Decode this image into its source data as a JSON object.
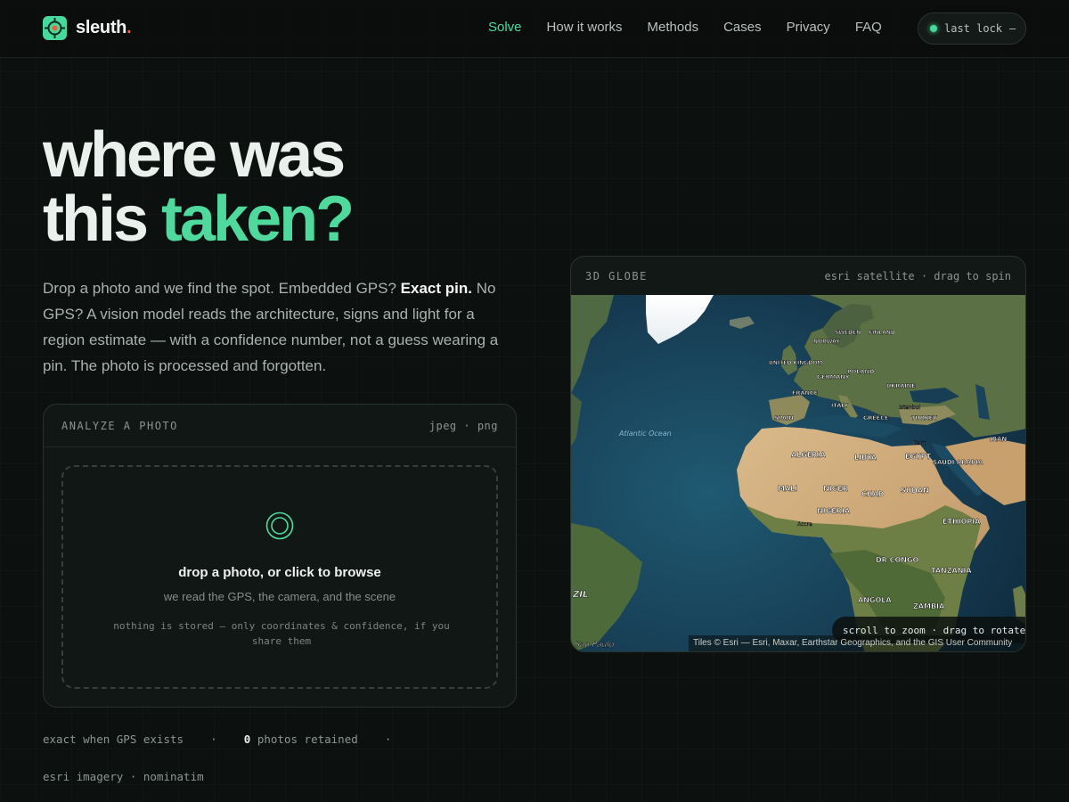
{
  "brand": {
    "name": "sleuth",
    "dot": "."
  },
  "nav": {
    "items": [
      {
        "label": "Solve",
        "active": true
      },
      {
        "label": "How it works",
        "active": false
      },
      {
        "label": "Methods",
        "active": false
      },
      {
        "label": "Cases",
        "active": false
      },
      {
        "label": "Privacy",
        "active": false
      },
      {
        "label": "FAQ",
        "active": false
      }
    ],
    "status_label": "last lock",
    "status_value": "–"
  },
  "hero": {
    "line1": "where was",
    "line2_plain": "this ",
    "line2_accent": "taken?",
    "sub_1": "Drop a photo and we find the spot. Embedded GPS? ",
    "sub_bold": "Exact pin.",
    "sub_2": " No GPS? A vision model reads the architecture, signs and light for a region estimate — with a confidence number, not a guess wearing a pin. The photo is processed and forgotten."
  },
  "analyze": {
    "title": "ANALYZE A PHOTO",
    "formats": "jpeg · png",
    "drop_title": "drop a photo, or click to browse",
    "drop_sub": "we read the GPS, the camera, and the scene",
    "drop_note": "nothing is stored — only coordinates & confidence, if you share them"
  },
  "stats": {
    "s1": "exact when GPS exists",
    "sep": "·",
    "count": "0",
    "s2": "photos retained",
    "s3": "esri imagery · nominatim"
  },
  "globe": {
    "title": "3D GLOBE",
    "meta": "esri satellite · drag to spin",
    "hint": "scroll to zoom · drag to rotate",
    "attribution": "Tiles © Esri — Esri, Maxar, Earthstar Geographics, and the GIS User Community",
    "labels": [
      "Atlantic Ocean",
      "ALGERIA",
      "LIBYA",
      "EGYPT",
      "MALI",
      "NIGER",
      "CHAD",
      "SUDAN",
      "NIGERIA",
      "ETHIOPIA",
      "DR CONGO",
      "TANZANIA",
      "ANGOLA",
      "ZAMBIA",
      "SPAIN",
      "FRANCE",
      "ITALY",
      "GREECE",
      "TURKEY",
      "GERMANY",
      "POLAND",
      "UKRAINE",
      "UNITED KINGDOM",
      "SWEDEN",
      "FINLAND",
      "NORWAY",
      "SAUDI ARABIA",
      "IRAN",
      "ZIL",
      "Sao Paulo",
      "Accra",
      "Cairo",
      "Istanbul"
    ]
  },
  "colors": {
    "accent": "#4fd99c",
    "brand_dot": "#ff5a3c",
    "background": "#0c100f"
  }
}
